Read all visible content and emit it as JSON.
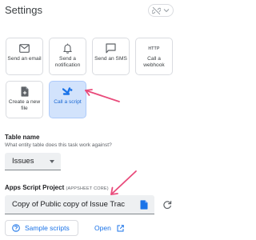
{
  "header": {
    "title": "Settings"
  },
  "tasks": [
    {
      "label": "Send an email",
      "icon": "email-icon"
    },
    {
      "label": "Send a notification",
      "icon": "bell-icon"
    },
    {
      "label": "Send an SMS",
      "icon": "sms-icon"
    },
    {
      "label": "Call a webhook",
      "icon": "webhook-icon",
      "icon_text": "HTTP"
    },
    {
      "label": "Create a new file",
      "icon": "file-icon"
    },
    {
      "label": "Call a script",
      "icon": "apps-script-icon",
      "selected": true
    }
  ],
  "table": {
    "title": "Table name",
    "help": "What entity table does this task work against?",
    "value": "Issues"
  },
  "script": {
    "title": "Apps Script Project",
    "tag": "(APPSHEET CORE)",
    "value": "Copy of Public copy of Issue Trac"
  },
  "actions": {
    "samples": "Sample scripts",
    "open": "Open"
  },
  "colors": {
    "accent": "#1a73e8",
    "selected_bg": "#d2e3fc",
    "annotation": "#e94b7b"
  }
}
